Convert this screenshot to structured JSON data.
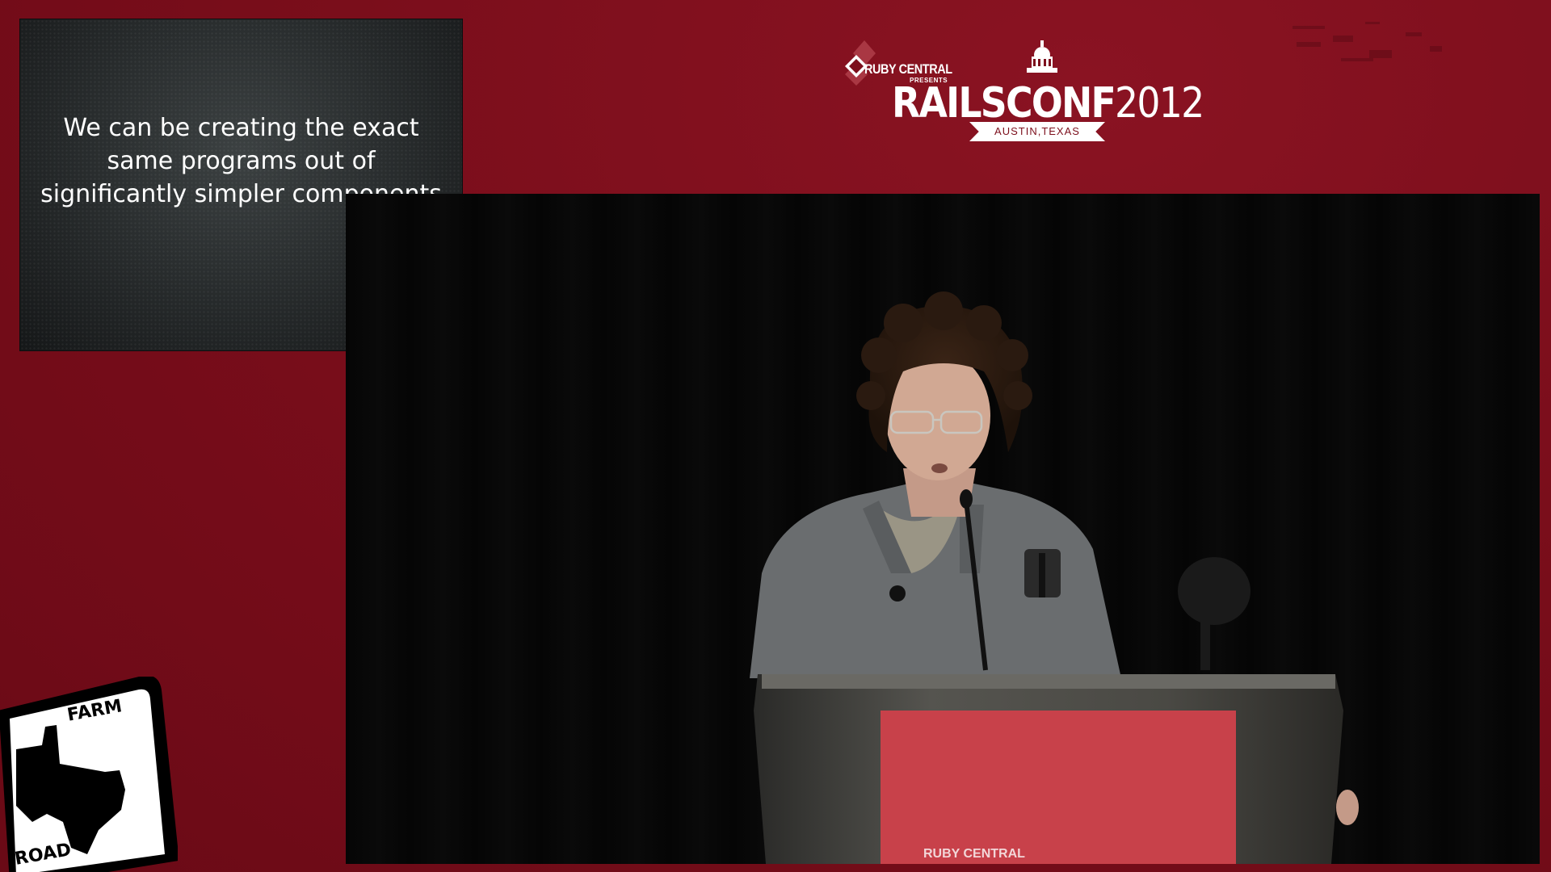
{
  "slide": {
    "text": "We can be creating the exact\nsame programs out of\nsignificantly simpler components"
  },
  "logo": {
    "presenter": "RUBY CENTRAL",
    "presents": "PRESENTS",
    "title_main": "RAILSCONF",
    "title_year": "2012",
    "location": "AUSTIN,TEXAS"
  },
  "podium": {
    "sign_text": "RUBY CENTRAL"
  },
  "shield": {
    "top_text": "FARM",
    "bottom_text": "ROAD"
  },
  "colors": {
    "background": "#7c0f1c",
    "slide_bg": "#2a2e2f",
    "podium_sign": "#c8414a"
  }
}
